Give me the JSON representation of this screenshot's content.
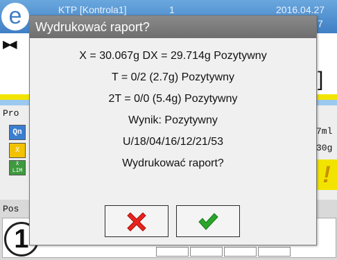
{
  "background": {
    "top_left": "KTP [Kontrola1]",
    "top_middle": "1",
    "top_right": "2016.04.27",
    "top_right_sub": "7",
    "label_pro": "Pro",
    "label_pos": "Pos",
    "value_ml": "7ml",
    "value_g": "30g",
    "big_digit": "1",
    "right_bracket": "]",
    "warning_mark": "!",
    "btn_q": "Qn",
    "btn_x": "x̄",
    "btn_lim": "x̄ LIM"
  },
  "dialog": {
    "title": "Wydrukować raport?",
    "lines": [
      "X = 30.067g DX = 29.714g Pozytywny",
      "T = 0/2 (2.7g) Pozytywny",
      "2T = 0/0 (5.4g) Pozytywny",
      "Wynik: Pozytywny",
      "U/18/04/16/12/21/53",
      "Wydrukować raport?"
    ]
  },
  "icons": {
    "cancel": "red-x-icon",
    "confirm": "green-check-icon"
  },
  "colors": {
    "cancel": "#e8231c",
    "confirm": "#2aa52a",
    "title_bar": "#7a7a7a"
  }
}
